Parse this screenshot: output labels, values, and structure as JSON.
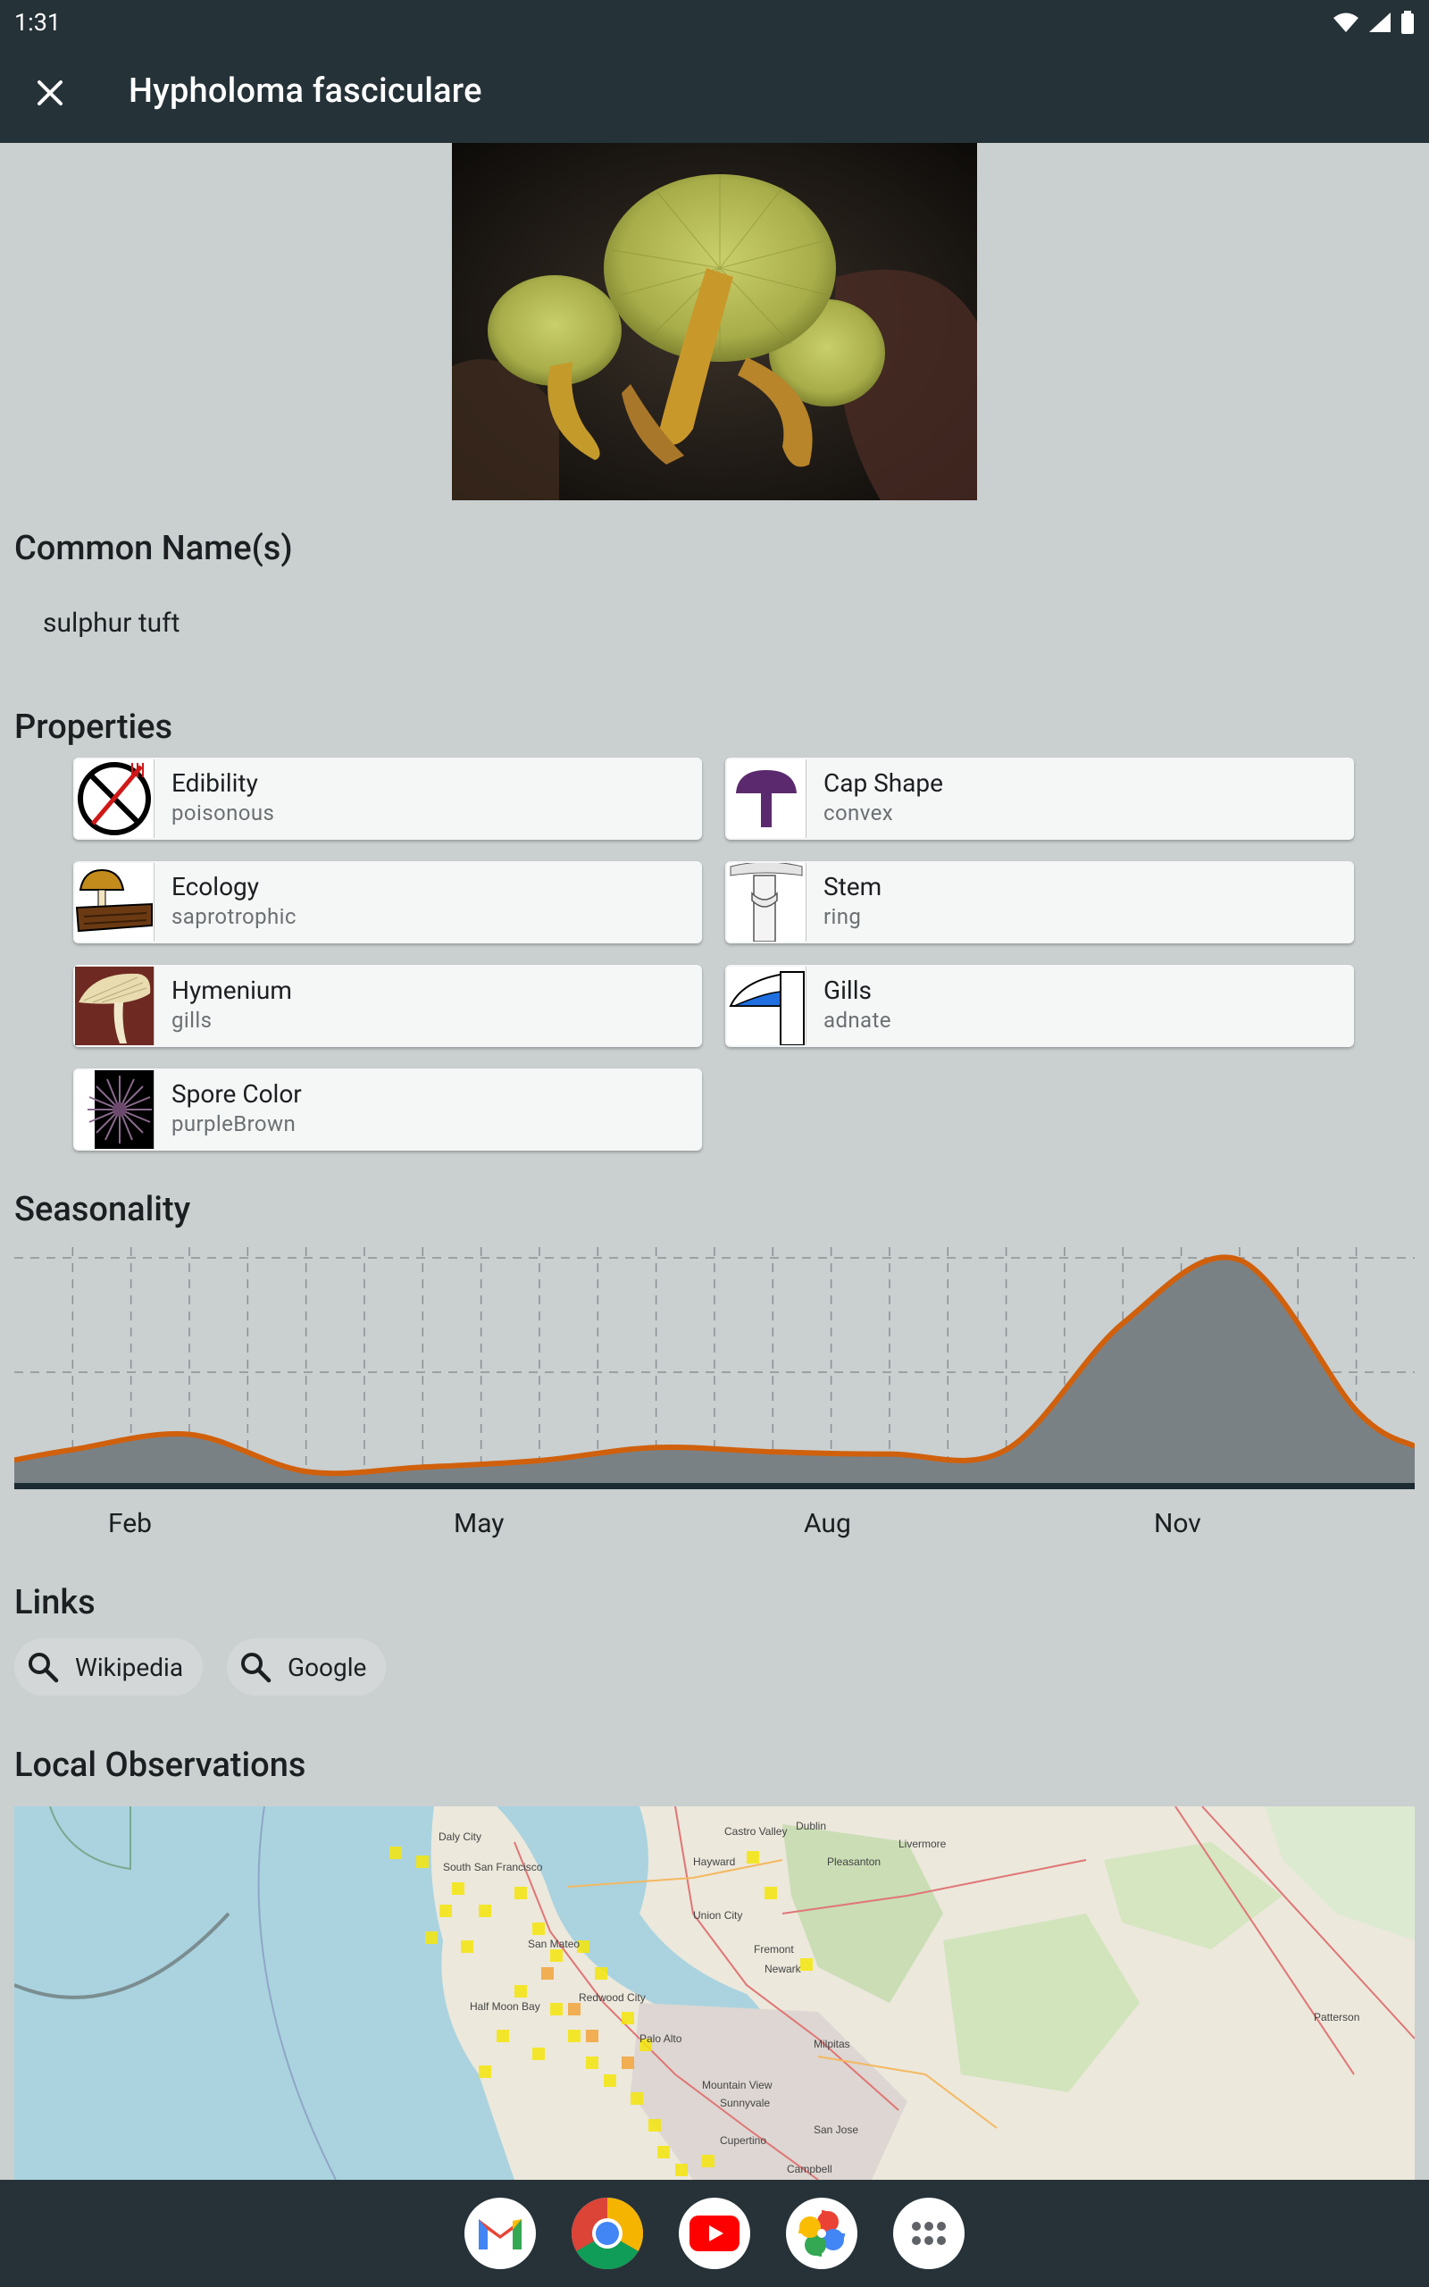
{
  "status_bar": {
    "time": "1:31"
  },
  "app_bar": {
    "title": "Hypholoma fasciculare"
  },
  "common_names": {
    "heading": "Common Name(s)",
    "names": [
      "sulphur tuft"
    ]
  },
  "properties": {
    "heading": "Properties",
    "items": [
      {
        "title": "Edibility",
        "value": "poisonous",
        "icon": "no-eat-icon"
      },
      {
        "title": "Cap Shape",
        "value": "convex",
        "icon": "cap-shape-icon"
      },
      {
        "title": "Ecology",
        "value": "saprotrophic",
        "icon": "ecology-icon"
      },
      {
        "title": "Stem",
        "value": "ring",
        "icon": "stem-ring-icon"
      },
      {
        "title": "Hymenium",
        "value": "gills",
        "icon": "hymenium-icon"
      },
      {
        "title": "Gills",
        "value": "adnate",
        "icon": "gills-icon"
      },
      {
        "title": "Spore Color",
        "value": "purpleBrown",
        "icon": "spore-print-icon"
      }
    ]
  },
  "seasonality": {
    "heading": "Seasonality",
    "month_labels": [
      "Feb",
      "May",
      "Aug",
      "Nov"
    ]
  },
  "chart_data": {
    "type": "area",
    "x": [
      "Jan",
      "Feb",
      "Mar",
      "Apr",
      "May",
      "Jun",
      "Jul",
      "Aug",
      "Sep",
      "Oct",
      "Nov",
      "Dec"
    ],
    "values": [
      0.12,
      0.19,
      0.02,
      0.04,
      0.07,
      0.13,
      0.11,
      0.1,
      0.12,
      0.7,
      0.99,
      0.3
    ],
    "ylim": [
      0,
      1
    ],
    "grid": true,
    "line_color": "#d0600c",
    "fill_color": "#7a8185"
  },
  "links": {
    "heading": "Links",
    "items": [
      {
        "label": "Wikipedia",
        "icon": "search-icon"
      },
      {
        "label": "Google",
        "icon": "search-icon"
      }
    ]
  },
  "observations": {
    "heading": "Local Observations",
    "map_labels": [
      "Daly City",
      "South San Francisco",
      "San Mateo",
      "Redwood City",
      "Palo Alto",
      "Half Moon Bay",
      "Hayward",
      "Union City",
      "Fremont",
      "Milpitas",
      "Mountain View",
      "Sunnyvale",
      "San Jose",
      "Cupertino",
      "Campbell",
      "Pleasanton",
      "Livermore",
      "Dublin",
      "Castro Valley",
      "Patterson",
      "Newark"
    ]
  },
  "dock": [
    "gmail-icon",
    "chrome-icon",
    "youtube-icon",
    "photos-icon",
    "app-drawer-icon"
  ],
  "colors": {
    "app_bar": "#253238",
    "background": "#cacfd0",
    "card": "#f5f6f6",
    "accent_line": "#d0600c"
  }
}
